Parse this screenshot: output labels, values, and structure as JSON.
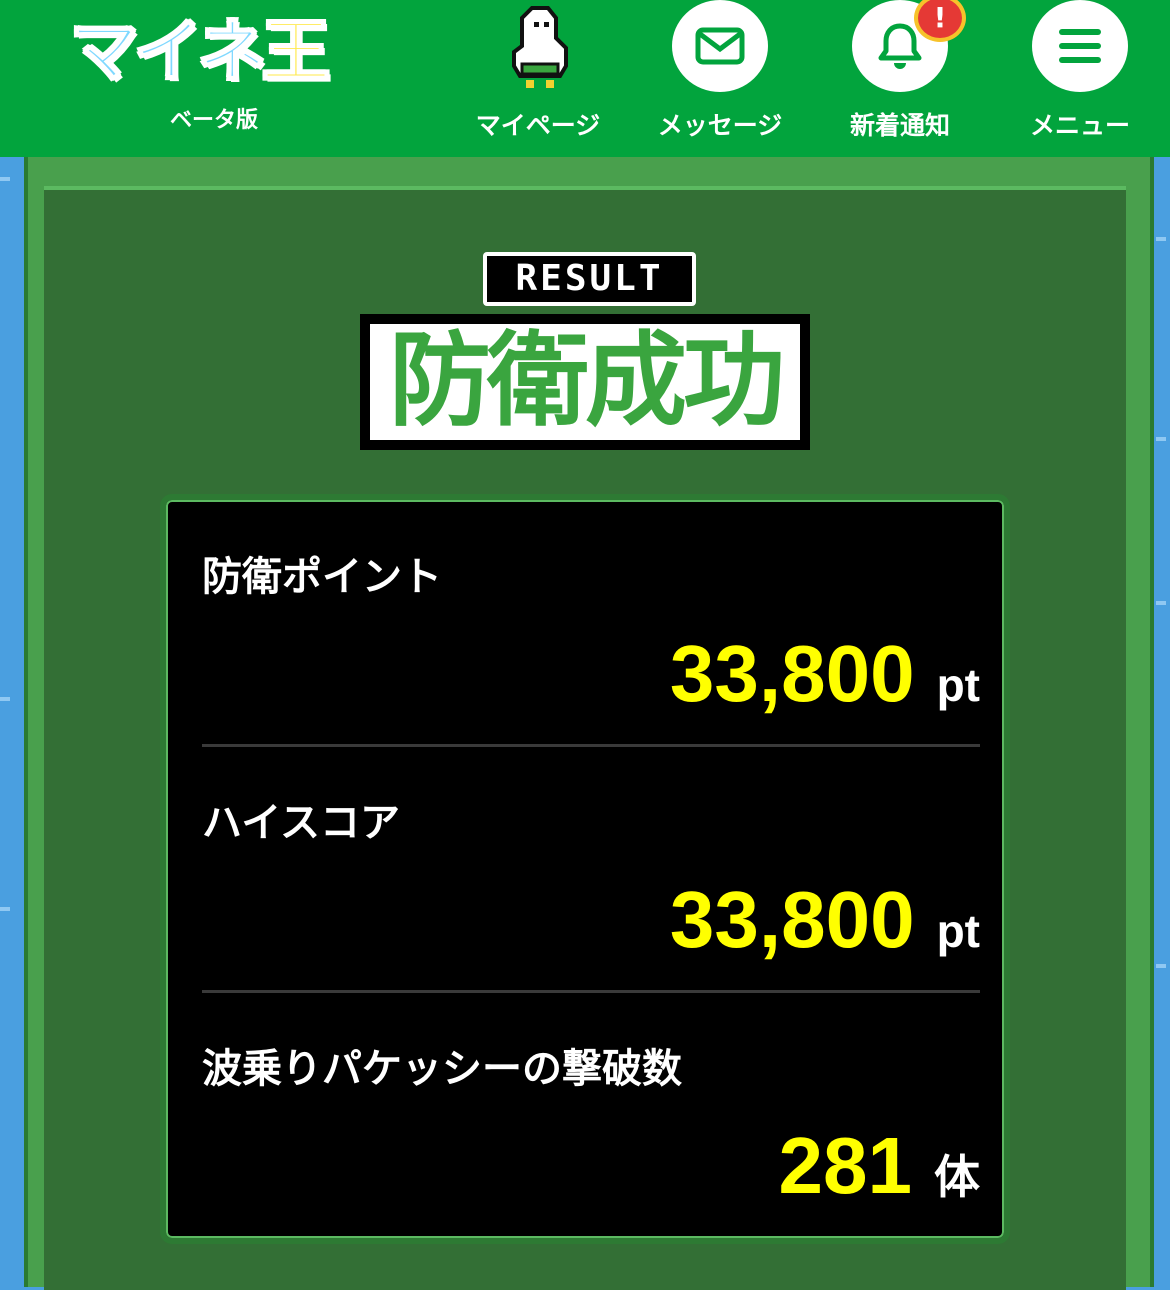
{
  "header": {
    "logo": {
      "text_main": "マイネ",
      "text_last": "王",
      "subtitle": "ベータ版"
    },
    "nav": [
      {
        "label": "マイページ",
        "icon": "bird-avatar-icon"
      },
      {
        "label": "メッセージ",
        "icon": "mail-icon"
      },
      {
        "label": "新着通知",
        "icon": "bell-icon",
        "badge": "!"
      },
      {
        "label": "メニュー",
        "icon": "hamburger-menu-icon"
      }
    ]
  },
  "result": {
    "tag": "RESULT",
    "title": "防衛成功"
  },
  "stats": [
    {
      "label": "防衛ポイント",
      "value": "33,800",
      "unit": "pt"
    },
    {
      "label": "ハイスコア",
      "value": "33,800",
      "unit": "pt"
    },
    {
      "label": "波乗りパケッシーの撃破数",
      "value": "281",
      "unit": "体"
    }
  ],
  "colors": {
    "header_bg": "#02a43d",
    "board_bg": "#336f35",
    "value_yellow": "#ffff00",
    "title_green": "#3aa53f",
    "badge_red": "#e53935"
  }
}
